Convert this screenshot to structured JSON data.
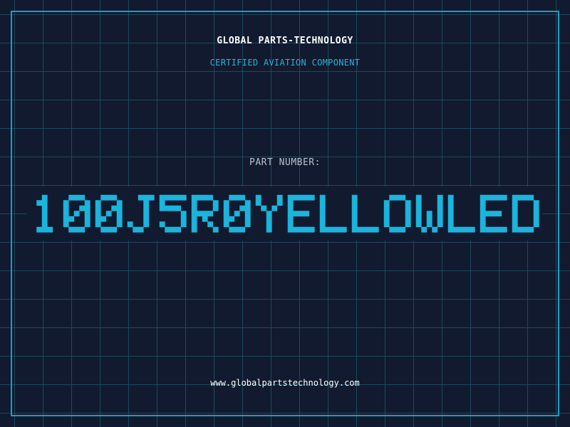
{
  "header": {
    "company_name": "GLOBAL PARTS-TECHNOLOGY",
    "tagline": "CERTIFIED AVIATION COMPONENT"
  },
  "part": {
    "label": "PART NUMBER:",
    "number": "100J5R0YELLOWLED"
  },
  "footer": {
    "url": "www.globalpartstechnology.com"
  },
  "colors": {
    "background": "#111a2e",
    "grid": "#1d4a5e",
    "frame": "#1a9ec6",
    "accent": "#2bb3d9",
    "part_number": "#1ab4dc"
  }
}
